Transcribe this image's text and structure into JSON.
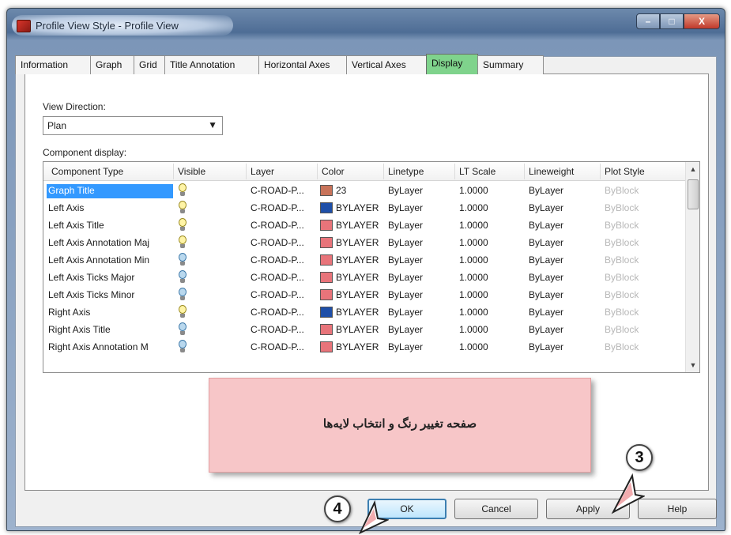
{
  "window": {
    "title": "Profile View Style - Profile View",
    "controls": {
      "minimize": "–",
      "maximize": "□",
      "close": "X"
    }
  },
  "tabs": [
    {
      "label": "Information",
      "active": false
    },
    {
      "label": "Graph",
      "active": false
    },
    {
      "label": "Grid",
      "active": false
    },
    {
      "label": "Title Annotation",
      "active": false
    },
    {
      "label": "Horizontal Axes",
      "active": false
    },
    {
      "label": "Vertical Axes",
      "active": false
    },
    {
      "label": "Display",
      "active": true
    },
    {
      "label": "Summary",
      "active": false
    }
  ],
  "view_direction": {
    "label": "View Direction:",
    "value": "Plan"
  },
  "component_display": {
    "label": "Component display:",
    "columns": [
      "Component Type",
      "Visible",
      "Layer",
      "Color",
      "Linetype",
      "LT Scale",
      "Lineweight",
      "Plot Style"
    ],
    "rows": [
      {
        "name": "Graph Title",
        "visible": "on",
        "layer": "C-ROAD-P...",
        "swatch": "#c8735a",
        "color": "23",
        "linetype": "ByLayer",
        "lt_scale": "1.0000",
        "lineweight": "ByLayer",
        "plot_style": "ByBlock",
        "selected": true
      },
      {
        "name": "Left Axis",
        "visible": "on",
        "layer": "C-ROAD-P...",
        "swatch": "#1e4fa8",
        "color": "BYLAYER",
        "linetype": "ByLayer",
        "lt_scale": "1.0000",
        "lineweight": "ByLayer",
        "plot_style": "ByBlock",
        "selected": false
      },
      {
        "name": "Left Axis Title",
        "visible": "on",
        "layer": "C-ROAD-P...",
        "swatch": "#e8747a",
        "color": "BYLAYER",
        "linetype": "ByLayer",
        "lt_scale": "1.0000",
        "lineweight": "ByLayer",
        "plot_style": "ByBlock",
        "selected": false
      },
      {
        "name": "Left Axis Annotation Maj",
        "visible": "on",
        "layer": "C-ROAD-P...",
        "swatch": "#e8747a",
        "color": "BYLAYER",
        "linetype": "ByLayer",
        "lt_scale": "1.0000",
        "lineweight": "ByLayer",
        "plot_style": "ByBlock",
        "selected": false
      },
      {
        "name": "Left Axis Annotation Min",
        "visible": "off",
        "layer": "C-ROAD-P...",
        "swatch": "#e8747a",
        "color": "BYLAYER",
        "linetype": "ByLayer",
        "lt_scale": "1.0000",
        "lineweight": "ByLayer",
        "plot_style": "ByBlock",
        "selected": false
      },
      {
        "name": "Left Axis Ticks Major",
        "visible": "off",
        "layer": "C-ROAD-P...",
        "swatch": "#e8747a",
        "color": "BYLAYER",
        "linetype": "ByLayer",
        "lt_scale": "1.0000",
        "lineweight": "ByLayer",
        "plot_style": "ByBlock",
        "selected": false
      },
      {
        "name": "Left Axis Ticks Minor",
        "visible": "off",
        "layer": "C-ROAD-P...",
        "swatch": "#e8747a",
        "color": "BYLAYER",
        "linetype": "ByLayer",
        "lt_scale": "1.0000",
        "lineweight": "ByLayer",
        "plot_style": "ByBlock",
        "selected": false
      },
      {
        "name": "Right Axis",
        "visible": "on",
        "layer": "C-ROAD-P...",
        "swatch": "#1e4fa8",
        "color": "BYLAYER",
        "linetype": "ByLayer",
        "lt_scale": "1.0000",
        "lineweight": "ByLayer",
        "plot_style": "ByBlock",
        "selected": false
      },
      {
        "name": "Right Axis Title",
        "visible": "off",
        "layer": "C-ROAD-P...",
        "swatch": "#e8747a",
        "color": "BYLAYER",
        "linetype": "ByLayer",
        "lt_scale": "1.0000",
        "lineweight": "ByLayer",
        "plot_style": "ByBlock",
        "selected": false
      },
      {
        "name": "Right Axis Annotation M",
        "visible": "off",
        "layer": "C-ROAD-P...",
        "swatch": "#e8747a",
        "color": "BYLAYER",
        "linetype": "ByLayer",
        "lt_scale": "1.0000",
        "lineweight": "ByLayer",
        "plot_style": "ByBlock",
        "selected": false
      }
    ]
  },
  "note": {
    "text": "صفحه تغییر رنگ و انتخاب لایه‌ها"
  },
  "buttons": {
    "ok": "OK",
    "cancel": "Cancel",
    "apply": "Apply",
    "help": "Help"
  },
  "annotations": {
    "step3": "3",
    "step4": "4"
  }
}
